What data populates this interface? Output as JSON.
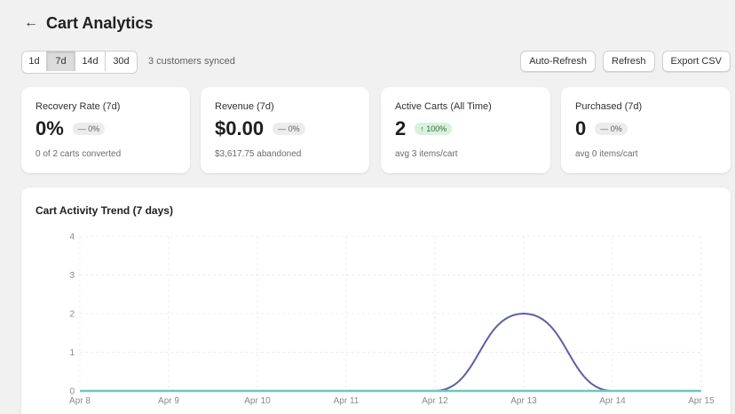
{
  "header": {
    "back_icon": "arrow-left-icon",
    "title": "Cart Analytics"
  },
  "toolbar": {
    "ranges": [
      "1d",
      "7d",
      "14d",
      "30d"
    ],
    "selected_range": "7d",
    "synced_text": "3 customers synced",
    "auto_refresh_label": "Auto-Refresh",
    "refresh_label": "Refresh",
    "export_label": "Export CSV"
  },
  "cards": [
    {
      "label": "Recovery Rate (7d)",
      "value": "0%",
      "badge": "— 0%",
      "sub": "0 of 2 carts converted"
    },
    {
      "label": "Revenue (7d)",
      "value": "$0.00",
      "badge": "— 0%",
      "sub": "$3,617.75 abandoned"
    },
    {
      "label": "Active Carts (All Time)",
      "value": "2",
      "badge": "↑ 100%",
      "sub": "avg 3 items/cart"
    },
    {
      "label": "Purchased (7d)",
      "value": "0",
      "badge": "— 0%",
      "sub": "avg 0 items/cart"
    }
  ],
  "colors": {
    "page_bg": "#f1f1f1",
    "card_bg": "#ffffff",
    "badge_positive_bg": "#d9f2dd",
    "series_active": "#5c5fa8",
    "series_purchased": "#6cc9b8"
  },
  "chart": {
    "title": "Cart Activity Trend (7 days)"
  },
  "chart_data": {
    "type": "line",
    "title": "Cart Activity Trend (7 days)",
    "x": [
      "Apr 8",
      "Apr 9",
      "Apr 10",
      "Apr 11",
      "Apr 12",
      "Apr 13",
      "Apr 14",
      "Apr 15"
    ],
    "yticks": [
      0,
      1,
      2,
      3,
      4
    ],
    "ylim": [
      0,
      4
    ],
    "grid": true,
    "series": [
      {
        "values": [
          0,
          0,
          0,
          0,
          0,
          2,
          0,
          0
        ],
        "color": "#5c5fa8"
      },
      {
        "values": [
          0,
          0,
          0,
          0,
          0,
          0,
          0,
          0
        ],
        "color": "#6cc9b8"
      }
    ]
  }
}
